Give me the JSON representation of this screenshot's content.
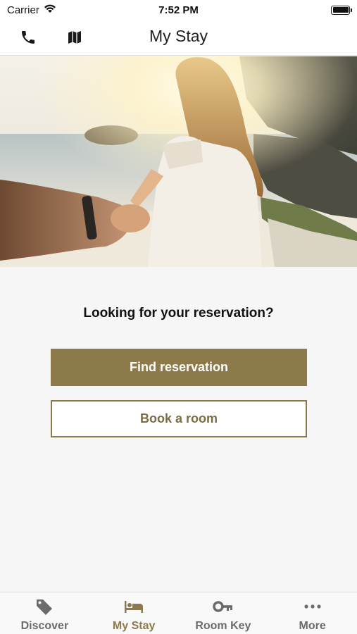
{
  "status_bar": {
    "carrier": "Carrier",
    "time": "7:52 PM"
  },
  "nav": {
    "title": "My Stay",
    "icons": [
      "phone-icon",
      "map-icon"
    ]
  },
  "hero": {
    "description": "beach photo with couple holding hands"
  },
  "main": {
    "prompt": "Looking for your reservation?",
    "primary_button": "Find reservation",
    "secondary_button": "Book a room"
  },
  "tab_bar": {
    "active": "My Stay",
    "tabs": [
      {
        "label": "Discover",
        "icon": "tag-icon"
      },
      {
        "label": "My Stay",
        "icon": "bed-icon"
      },
      {
        "label": "Room Key",
        "icon": "key-icon"
      },
      {
        "label": "More",
        "icon": "more-dots-icon"
      }
    ]
  },
  "colors": {
    "accent": "#8c7a4a",
    "inactive_tab": "#6b6b6b",
    "background": "#f6f6f6"
  }
}
